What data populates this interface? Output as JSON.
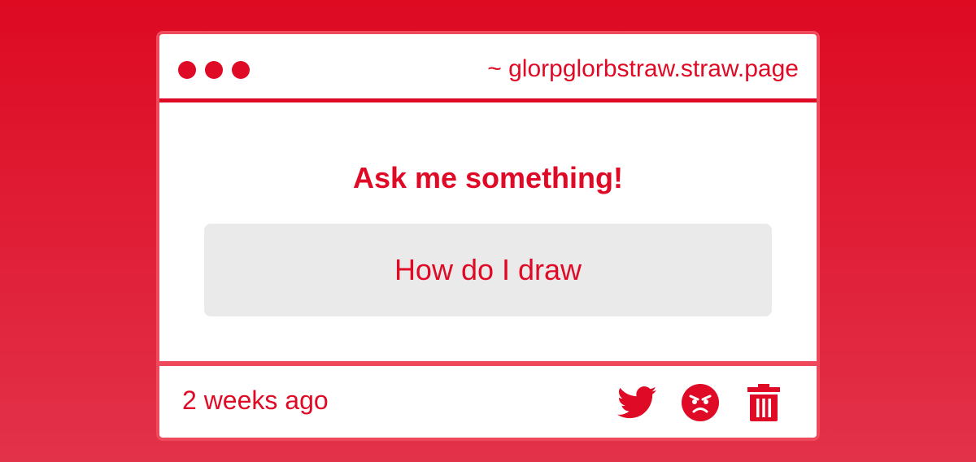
{
  "window": {
    "url": "~ glorpglorbstraw.straw.page"
  },
  "main": {
    "heading": "Ask me something!",
    "question": "How do I draw"
  },
  "footer": {
    "timestamp": "2 weeks ago",
    "actions": [
      {
        "icon": "twitter-icon"
      },
      {
        "icon": "angry-face-icon"
      },
      {
        "icon": "trash-icon"
      }
    ]
  },
  "colors": {
    "accent": "#df0a25",
    "border": "#ef4a5c",
    "question_bg": "#ebeaeb",
    "card_bg": "#ffffff"
  }
}
